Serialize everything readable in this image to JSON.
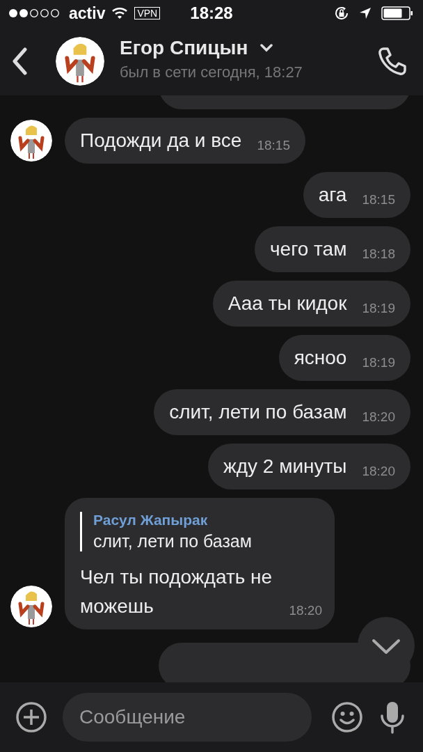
{
  "status_bar": {
    "carrier": "activ",
    "vpn": "VPN",
    "time": "18:28"
  },
  "header": {
    "name": "Егор Спицын",
    "last_seen": "был в сети сегодня, 18:27"
  },
  "messages": [
    {
      "kind": "outgoing_partial"
    },
    {
      "kind": "incoming",
      "text": "Подожди да и все",
      "time": "18:15"
    },
    {
      "kind": "outgoing",
      "text": "ага",
      "time": "18:15"
    },
    {
      "kind": "outgoing",
      "text": "чего там",
      "time": "18:18"
    },
    {
      "kind": "outgoing",
      "text": "Ааа ты кидок",
      "time": "18:19"
    },
    {
      "kind": "outgoing",
      "text": "ясноо",
      "time": "18:19"
    },
    {
      "kind": "outgoing",
      "text": "слит, лети по базам",
      "time": "18:20"
    },
    {
      "kind": "outgoing",
      "text": "жду 2 минуты",
      "time": "18:20"
    },
    {
      "kind": "incoming_reply",
      "quote_author": "Расул Жапырак",
      "quote_text": "слит, лети по базам",
      "text": "Чел ты подождать не можешь",
      "time": "18:20"
    },
    {
      "kind": "outgoing_partial"
    }
  ],
  "composer": {
    "placeholder": "Сообщение"
  }
}
